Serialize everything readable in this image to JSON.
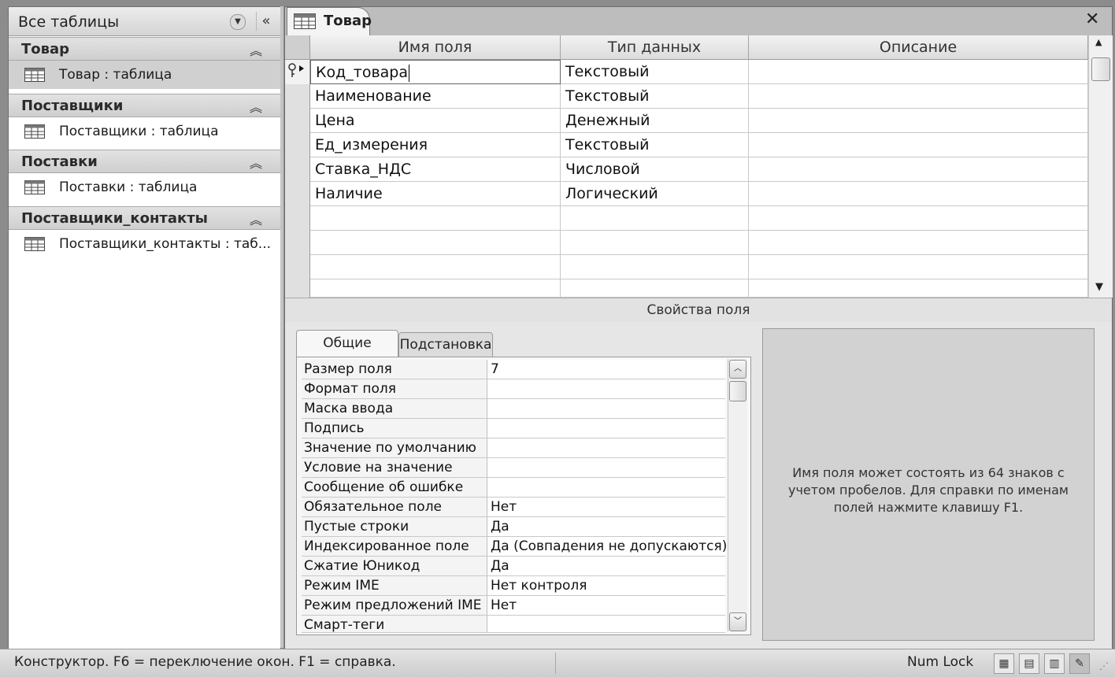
{
  "nav": {
    "title": "Все таблицы",
    "groups": [
      {
        "title": "Товар",
        "item": "Товар : таблица"
      },
      {
        "title": "Поставщики",
        "item": "Поставщики : таблица"
      },
      {
        "title": "Поставки",
        "item": "Поставки : таблица"
      },
      {
        "title": "Поставщики_контакты",
        "item": "Поставщики_контакты : таб..."
      }
    ]
  },
  "document": {
    "tab_label": "Товар",
    "close_glyph": "✕"
  },
  "grid": {
    "headers": [
      "Имя поля",
      "Тип данных",
      "Описание"
    ],
    "rows": [
      {
        "name": "Код_товара",
        "type": "Текстовый",
        "description": ""
      },
      {
        "name": "Наименование",
        "type": "Текстовый",
        "description": ""
      },
      {
        "name": "Цена",
        "type": "Денежный",
        "description": ""
      },
      {
        "name": "Ед_измерения",
        "type": "Текстовый",
        "description": ""
      },
      {
        "name": "Ставка_НДС",
        "type": "Числовой",
        "description": ""
      },
      {
        "name": "Наличие",
        "type": "Логический",
        "description": ""
      }
    ],
    "primary_key_row": 0
  },
  "properties": {
    "title": "Свойства поля",
    "tabs": [
      "Общие",
      "Подстановка"
    ],
    "active_tab": "Общие",
    "rows": [
      {
        "label": "Размер поля",
        "value": "7"
      },
      {
        "label": "Формат поля",
        "value": ""
      },
      {
        "label": "Маска ввода",
        "value": ""
      },
      {
        "label": "Подпись",
        "value": ""
      },
      {
        "label": "Значение по умолчанию",
        "value": ""
      },
      {
        "label": "Условие на значение",
        "value": ""
      },
      {
        "label": "Сообщение об ошибке",
        "value": ""
      },
      {
        "label": "Обязательное поле",
        "value": "Нет"
      },
      {
        "label": "Пустые строки",
        "value": "Да"
      },
      {
        "label": "Индексированное поле",
        "value": "Да (Совпадения не допускаются)"
      },
      {
        "label": "Сжатие Юникод",
        "value": "Да"
      },
      {
        "label": "Режим IME",
        "value": "Нет контроля"
      },
      {
        "label": "Режим предложений IME",
        "value": "Нет"
      },
      {
        "label": "Смарт-теги",
        "value": ""
      }
    ],
    "help_text": "Имя поля может состоять из 64 знаков с учетом пробелов. Для справки по именам полей нажмите клавишу F1."
  },
  "status_bar": {
    "text": "Конструктор.  F6 = переключение окон.  F1 = справка.",
    "num_lock": "Num Lock",
    "view_buttons": [
      "datasheet-view-icon",
      "pivot-table-view-icon",
      "pivot-chart-view-icon",
      "design-view-icon"
    ]
  }
}
